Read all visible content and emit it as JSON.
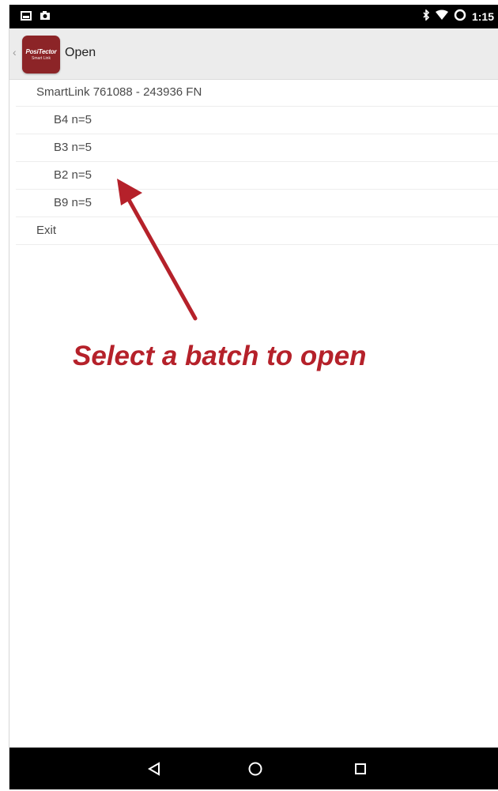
{
  "status_bar": {
    "time": "1:15",
    "icons": [
      "screenshot-icon",
      "photo-icon",
      "bluetooth-icon",
      "wifi-icon",
      "battery-icon"
    ]
  },
  "action_bar": {
    "title": "Open",
    "logo_line1": "PosiTector",
    "logo_line2": "Smart Link"
  },
  "list": {
    "header": "SmartLink 761088 - 243936 FN",
    "batches": [
      {
        "label": "B4  n=5"
      },
      {
        "label": "B3  n=5"
      },
      {
        "label": "B2  n=5"
      },
      {
        "label": "B9  n=5"
      }
    ],
    "exit": "Exit"
  },
  "annotation": {
    "text": "Select a batch to open",
    "color": "#b5212a"
  },
  "nav_bar": {
    "icons": [
      "back-icon",
      "home-icon",
      "recents-icon"
    ]
  }
}
